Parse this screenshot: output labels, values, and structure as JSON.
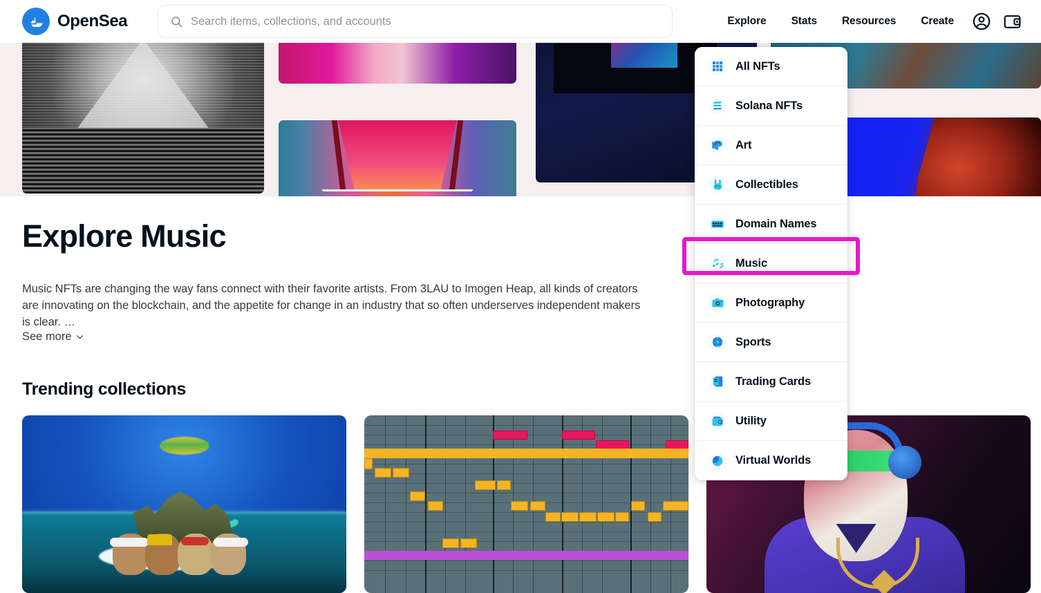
{
  "header": {
    "brand": {
      "name": "OpenSea",
      "logo_icon": "opensea-boat-logo",
      "color": "#2081e2"
    },
    "search": {
      "placeholder": "Search items, collections, and accounts",
      "value": "",
      "icon": "search-icon"
    },
    "nav_links": [
      {
        "label": "Explore"
      },
      {
        "label": "Stats"
      },
      {
        "label": "Resources"
      },
      {
        "label": "Create"
      }
    ],
    "nav_icons": [
      {
        "name": "account-icon"
      },
      {
        "name": "wallet-icon"
      }
    ]
  },
  "dropdown": {
    "highlight_color": "#e818c8",
    "highlighted_item": "Music",
    "items": [
      {
        "label": "All NFTs",
        "icon": "grid-icon"
      },
      {
        "label": "Solana NFTs",
        "icon": "solana-icon"
      },
      {
        "label": "Art",
        "icon": "palette-icon"
      },
      {
        "label": "Collectibles",
        "icon": "rabbit-icon"
      },
      {
        "label": "Domain Names",
        "icon": "domain-icon"
      },
      {
        "label": "Music",
        "icon": "music-note-icon"
      },
      {
        "label": "Photography",
        "icon": "camera-icon"
      },
      {
        "label": "Sports",
        "icon": "ball-icon"
      },
      {
        "label": "Trading Cards",
        "icon": "cards-icon"
      },
      {
        "label": "Utility",
        "icon": "wallet-icon"
      },
      {
        "label": "Virtual Worlds",
        "icon": "globe-icon"
      }
    ]
  },
  "main": {
    "page_title": "Explore Music",
    "description": "Music NFTs are changing the way fans connect with their favorite artists. From 3LAU to Imogen Heap, all kinds of creators are innovating on the blockchain, and the appetite for change in an industry that so often underserves independent makers is clear. …",
    "see_more_label": "See more",
    "see_more_icon": "chevron-down-icon",
    "section_title": "Trending collections",
    "cards": [
      {
        "name": "bored-ape-island-collection"
      },
      {
        "name": "piano-roll-music-collection"
      },
      {
        "name": "headphones-avatar-collection"
      }
    ]
  },
  "hero": {
    "background": "#f5eff0",
    "tiles": [
      {
        "name": "halftone-pyramid-art"
      },
      {
        "name": "purple-film-strip-art"
      },
      {
        "name": "pink-gradient-top-art"
      },
      {
        "name": "neon-triangle-corridor-art"
      },
      {
        "name": "dark-screen-art"
      },
      {
        "name": "blue-light-art"
      },
      {
        "name": "teal-photo-art"
      },
      {
        "name": "red-creature-art"
      }
    ]
  }
}
